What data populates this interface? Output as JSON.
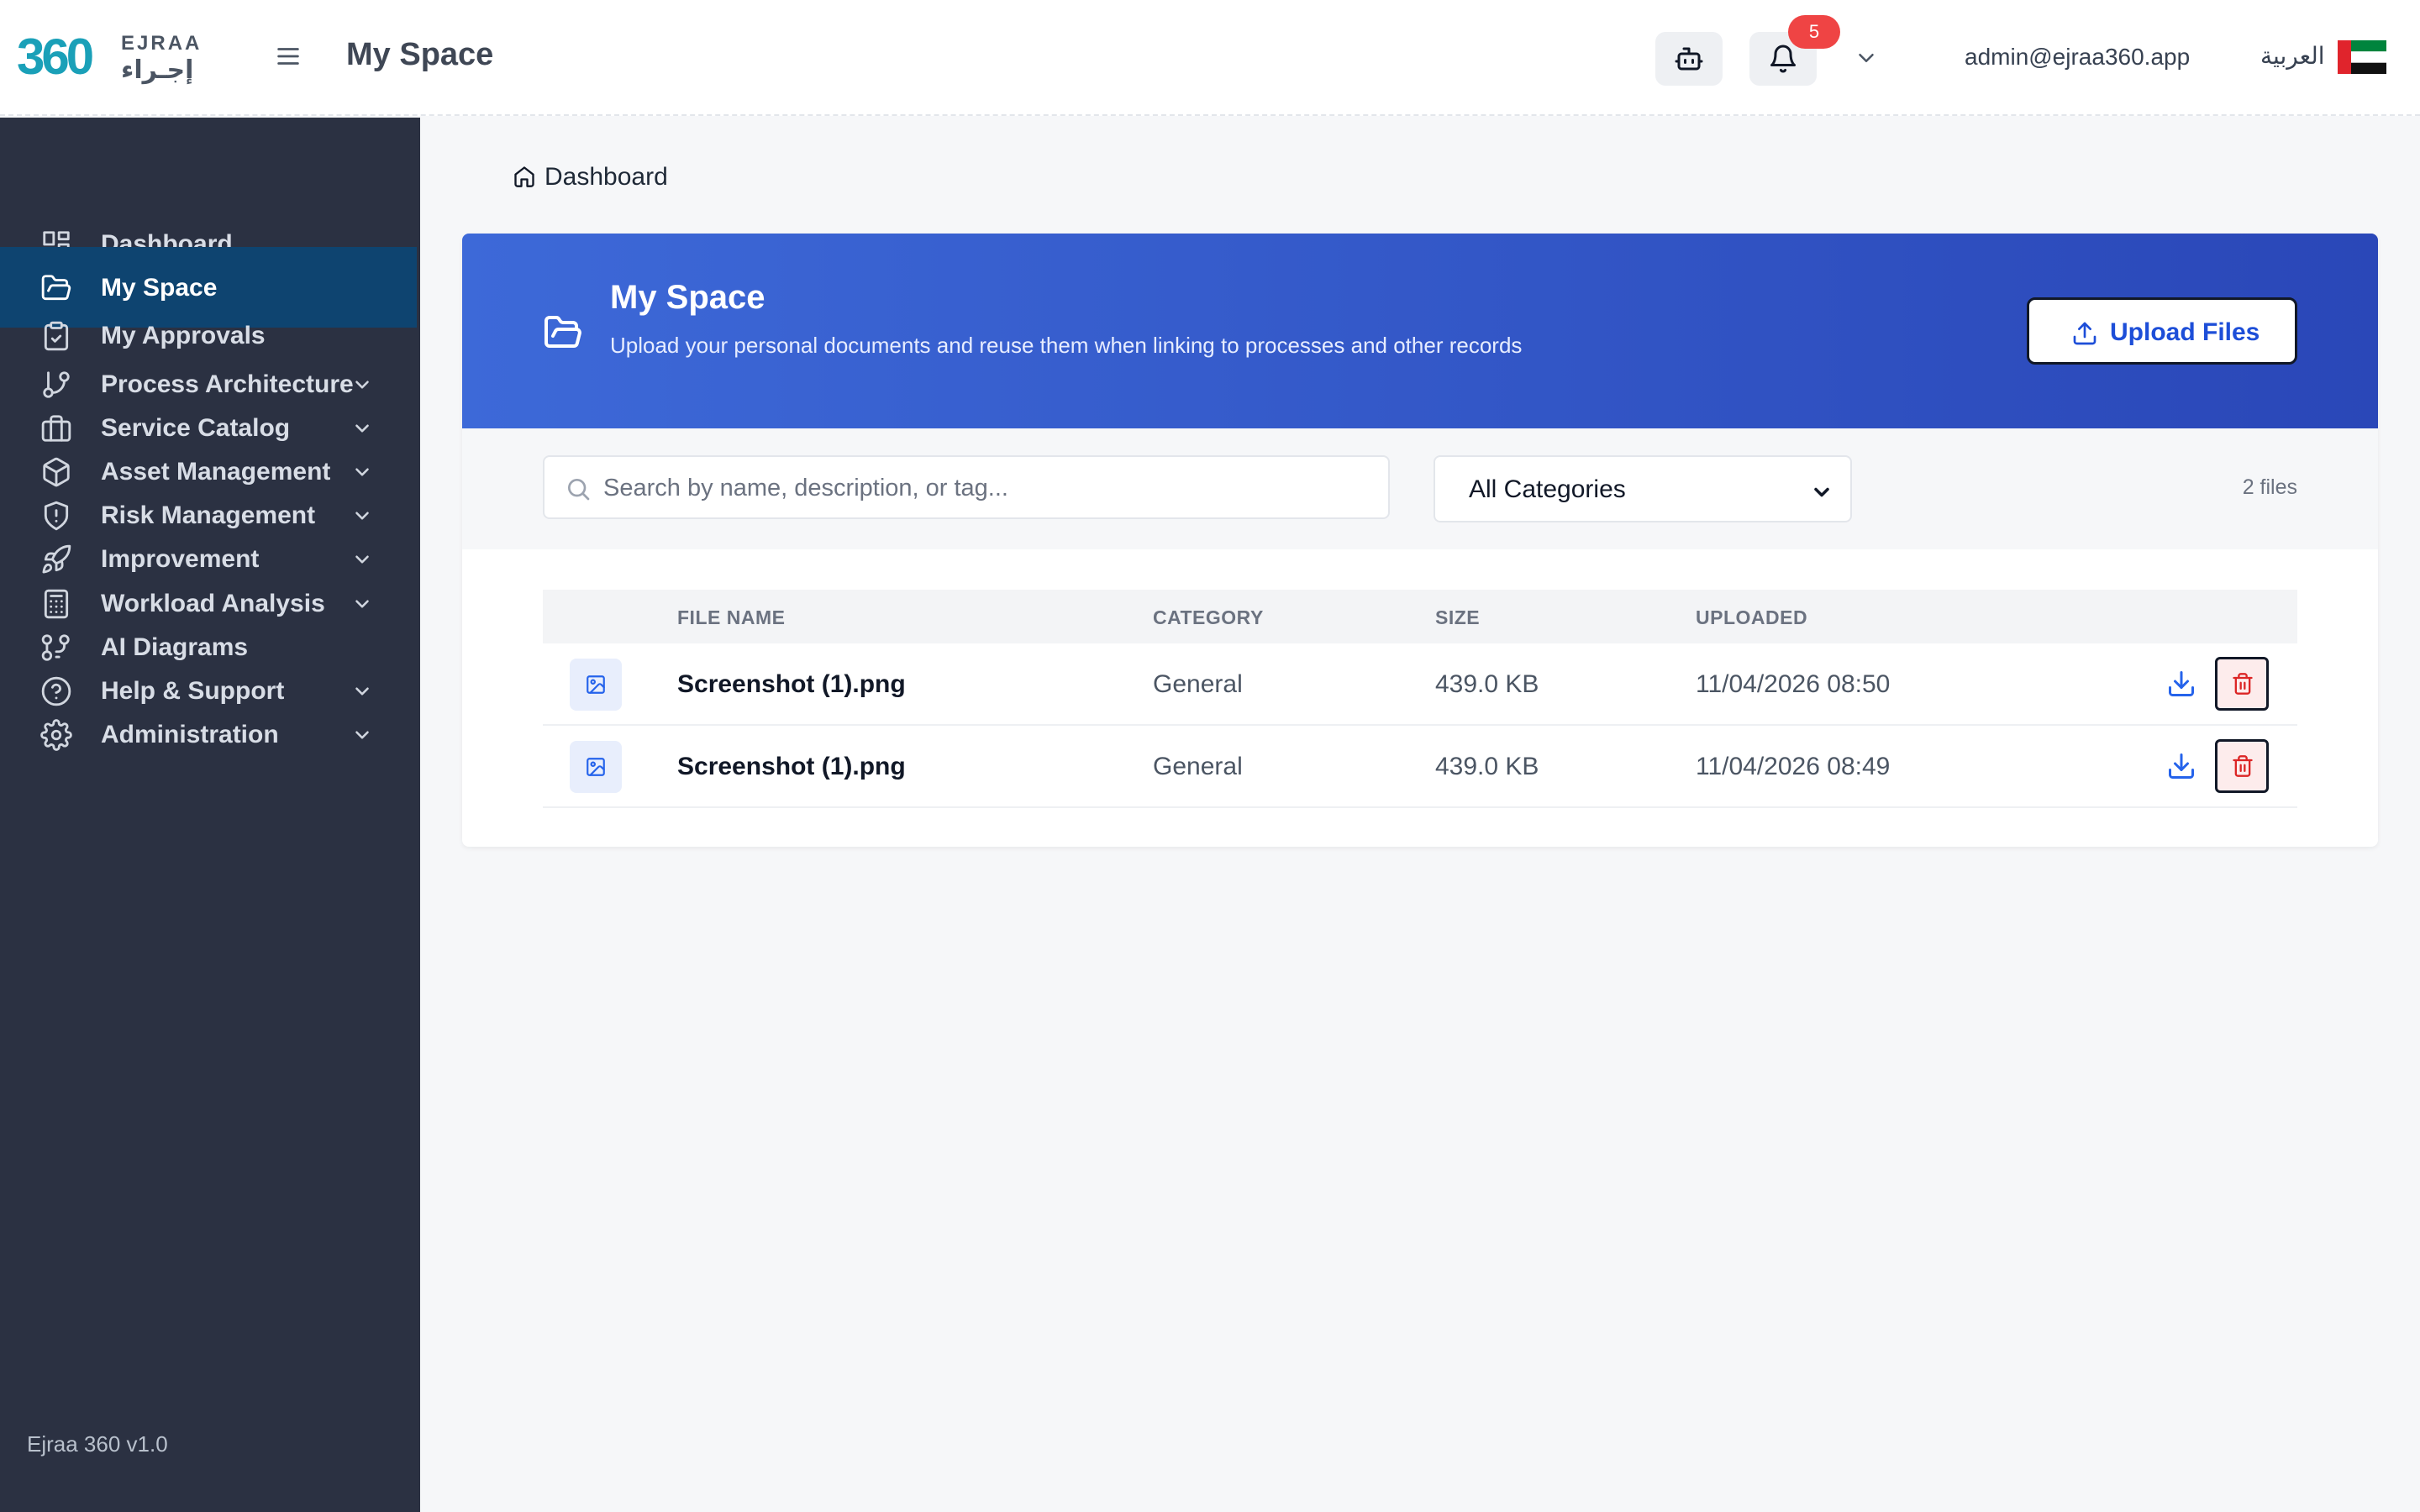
{
  "app": {
    "logo_number": "360",
    "logo_en": "EJRAA",
    "logo_ar": "إجـراء",
    "page_title": "My Space"
  },
  "header": {
    "notification_count": "5",
    "user_email": "admin@ejraa360.app",
    "language_label": "العربية",
    "icons": [
      "menu-icon",
      "robot-icon",
      "bell-icon",
      "chevron-down-icon",
      "uae-flag-icon"
    ]
  },
  "sidebar": {
    "items": [
      {
        "label": "Dashboard",
        "icon": "dashboard-grid-icon",
        "has_submenu": false,
        "active": false
      },
      {
        "label": "My Space",
        "icon": "folder-open-icon",
        "has_submenu": false,
        "active": true
      },
      {
        "label": "My Approvals",
        "icon": "clipboard-check-icon",
        "has_submenu": false,
        "active": false
      },
      {
        "label": "Process Architecture",
        "icon": "git-branch-icon",
        "has_submenu": true,
        "active": false
      },
      {
        "label": "Service Catalog",
        "icon": "briefcase-icon",
        "has_submenu": true,
        "active": false
      },
      {
        "label": "Asset Management",
        "icon": "box-icon",
        "has_submenu": true,
        "active": false
      },
      {
        "label": "Risk Management",
        "icon": "shield-alert-icon",
        "has_submenu": true,
        "active": false
      },
      {
        "label": "Improvement",
        "icon": "rocket-icon",
        "has_submenu": true,
        "active": false
      },
      {
        "label": "Workload Analysis",
        "icon": "calculator-icon",
        "has_submenu": true,
        "active": false
      },
      {
        "label": "AI Diagrams",
        "icon": "workflow-icon",
        "has_submenu": false,
        "active": false
      },
      {
        "label": "Help & Support",
        "icon": "help-circle-icon",
        "has_submenu": true,
        "active": false
      },
      {
        "label": "Administration",
        "icon": "gear-icon",
        "has_submenu": true,
        "active": false
      }
    ],
    "version": "Ejraa 360 v1.0"
  },
  "breadcrumb": {
    "label": "Dashboard"
  },
  "banner": {
    "title": "My Space",
    "subtitle": "Upload your personal documents and reuse them when linking to processes and other records",
    "upload_label": "Upload Files"
  },
  "filters": {
    "search_placeholder": "Search by name, description, or tag...",
    "category_selected": "All Categories",
    "file_count": "2 files"
  },
  "table": {
    "columns": [
      "FILE NAME",
      "CATEGORY",
      "SIZE",
      "UPLOADED"
    ],
    "rows": [
      {
        "name": "Screenshot (1).png",
        "category": "General",
        "size": "439.0 KB",
        "uploaded": "11/04/2026 08:50"
      },
      {
        "name": "Screenshot (1).png",
        "category": "General",
        "size": "439.0 KB",
        "uploaded": "11/04/2026 08:49"
      }
    ]
  },
  "colors": {
    "sidebar_bg": "#2b3142",
    "sidebar_active": "#0e4470",
    "banner_start": "#3d69d8",
    "banner_end": "#2a47b8",
    "accent": "#1d4ed8",
    "danger": "#dc2626",
    "badge": "#ef4444",
    "logo": "#1aa0b8"
  }
}
